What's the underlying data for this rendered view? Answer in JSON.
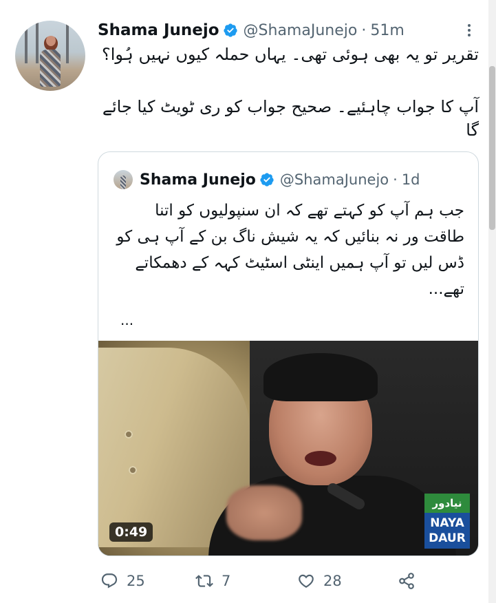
{
  "tweet": {
    "author_name": "Shama Junejo",
    "author_handle": "@ShamaJunejo",
    "separator": "·",
    "time": "51m",
    "text_line1": "تقریر تو یہ بھی ہوئی تھی۔ یہاں حملہ کیوں نہیں ہُوا؟",
    "text_line2": "آپ کا جواب چاہئیے۔ صحیح جواب کو ری ٹویٹ کیا جائے گا"
  },
  "quoted_tweet": {
    "author_name": "Shama Junejo",
    "author_handle": "@ShamaJunejo",
    "separator": "·",
    "time": "1d",
    "text": "جب ہم آپ کو کہتے تھے کہ ان سنپولیوں کو اتنا طاقت ور نہ بنائیں کہ یہ شیش ناگ بن کے آپ ہی کو ڈس لیں تو آپ ہمیں اینٹی اسٹیٹ کہہ کے دھمکاتے تھے...",
    "more": "...",
    "video": {
      "duration": "0:49",
      "logo_urdu": "نیادور",
      "logo_line1": "NAYA",
      "logo_line2": "DAUR"
    }
  },
  "actions": {
    "replies": "25",
    "retweets": "7",
    "likes": "28"
  },
  "icons": [
    "verified-badge-icon",
    "more-options-icon",
    "reply-icon",
    "retweet-icon",
    "like-icon",
    "share-icon"
  ],
  "colors": {
    "verified": "#1d9bf0",
    "secondary_text": "#536471",
    "border": "#cfd9de"
  }
}
